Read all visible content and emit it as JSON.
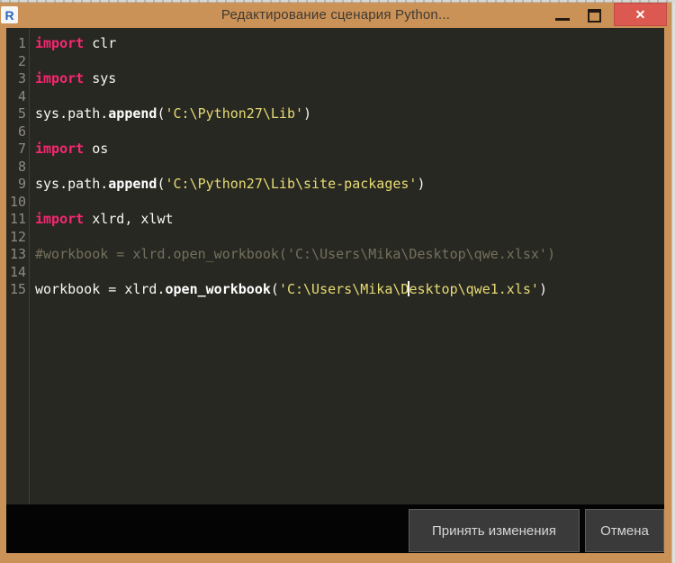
{
  "window": {
    "title": "Редактирование сценария Python...",
    "app_icon_letter": "R",
    "close_glyph": "✕"
  },
  "colors": {
    "titlebar": "#cb9257",
    "close_button": "#dc5952",
    "editor_background": "#282822",
    "keyword": "#f92672",
    "string": "#e6db74",
    "comment": "#74705d",
    "text": "#f8f8f2",
    "line_number": "#8b8b7d",
    "footer": "#040404",
    "dialog_button": "#3a3a3a"
  },
  "editor": {
    "lines": [
      {
        "num": "1",
        "tokens": [
          {
            "t": "keyword",
            "s": "import"
          },
          {
            "t": "plain",
            "s": " clr"
          }
        ]
      },
      {
        "num": "2",
        "tokens": []
      },
      {
        "num": "3",
        "tokens": [
          {
            "t": "keyword",
            "s": "import"
          },
          {
            "t": "plain",
            "s": " sys"
          }
        ]
      },
      {
        "num": "4",
        "tokens": []
      },
      {
        "num": "5",
        "tokens": [
          {
            "t": "plain",
            "s": "sys.path."
          },
          {
            "t": "function",
            "s": "append"
          },
          {
            "t": "plain",
            "s": "("
          },
          {
            "t": "string",
            "s": "'C:\\Python27\\Lib'"
          },
          {
            "t": "plain",
            "s": ")"
          }
        ]
      },
      {
        "num": "6",
        "tokens": []
      },
      {
        "num": "7",
        "tokens": [
          {
            "t": "keyword",
            "s": "import"
          },
          {
            "t": "plain",
            "s": " os"
          }
        ]
      },
      {
        "num": "8",
        "tokens": []
      },
      {
        "num": "9",
        "tokens": [
          {
            "t": "plain",
            "s": "sys.path."
          },
          {
            "t": "function",
            "s": "append"
          },
          {
            "t": "plain",
            "s": "("
          },
          {
            "t": "string",
            "s": "'C:\\Python27\\Lib\\site-packages'"
          },
          {
            "t": "plain",
            "s": ")"
          }
        ]
      },
      {
        "num": "10",
        "tokens": []
      },
      {
        "num": "11",
        "tokens": [
          {
            "t": "keyword",
            "s": "import"
          },
          {
            "t": "plain",
            "s": " xlrd, xlwt"
          }
        ]
      },
      {
        "num": "12",
        "tokens": []
      },
      {
        "num": "13",
        "tokens": [
          {
            "t": "comment",
            "s": "#workbook = xlrd.open_workbook('C:\\Users\\Mika\\Desktop\\qwe.xlsx')"
          }
        ]
      },
      {
        "num": "14",
        "tokens": []
      },
      {
        "num": "15",
        "tokens": [
          {
            "t": "plain",
            "s": "workbook = xlrd."
          },
          {
            "t": "function",
            "s": "open_workbook"
          },
          {
            "t": "plain",
            "s": "("
          },
          {
            "t": "string",
            "s": "'C:\\Users\\Mika\\D"
          },
          {
            "t": "caret",
            "s": ""
          },
          {
            "t": "string",
            "s": "esktop\\qwe1.xls'"
          },
          {
            "t": "plain",
            "s": ")"
          }
        ]
      }
    ]
  },
  "footer": {
    "accept_button": "Принять изменения",
    "cancel_button": "Отмена"
  }
}
